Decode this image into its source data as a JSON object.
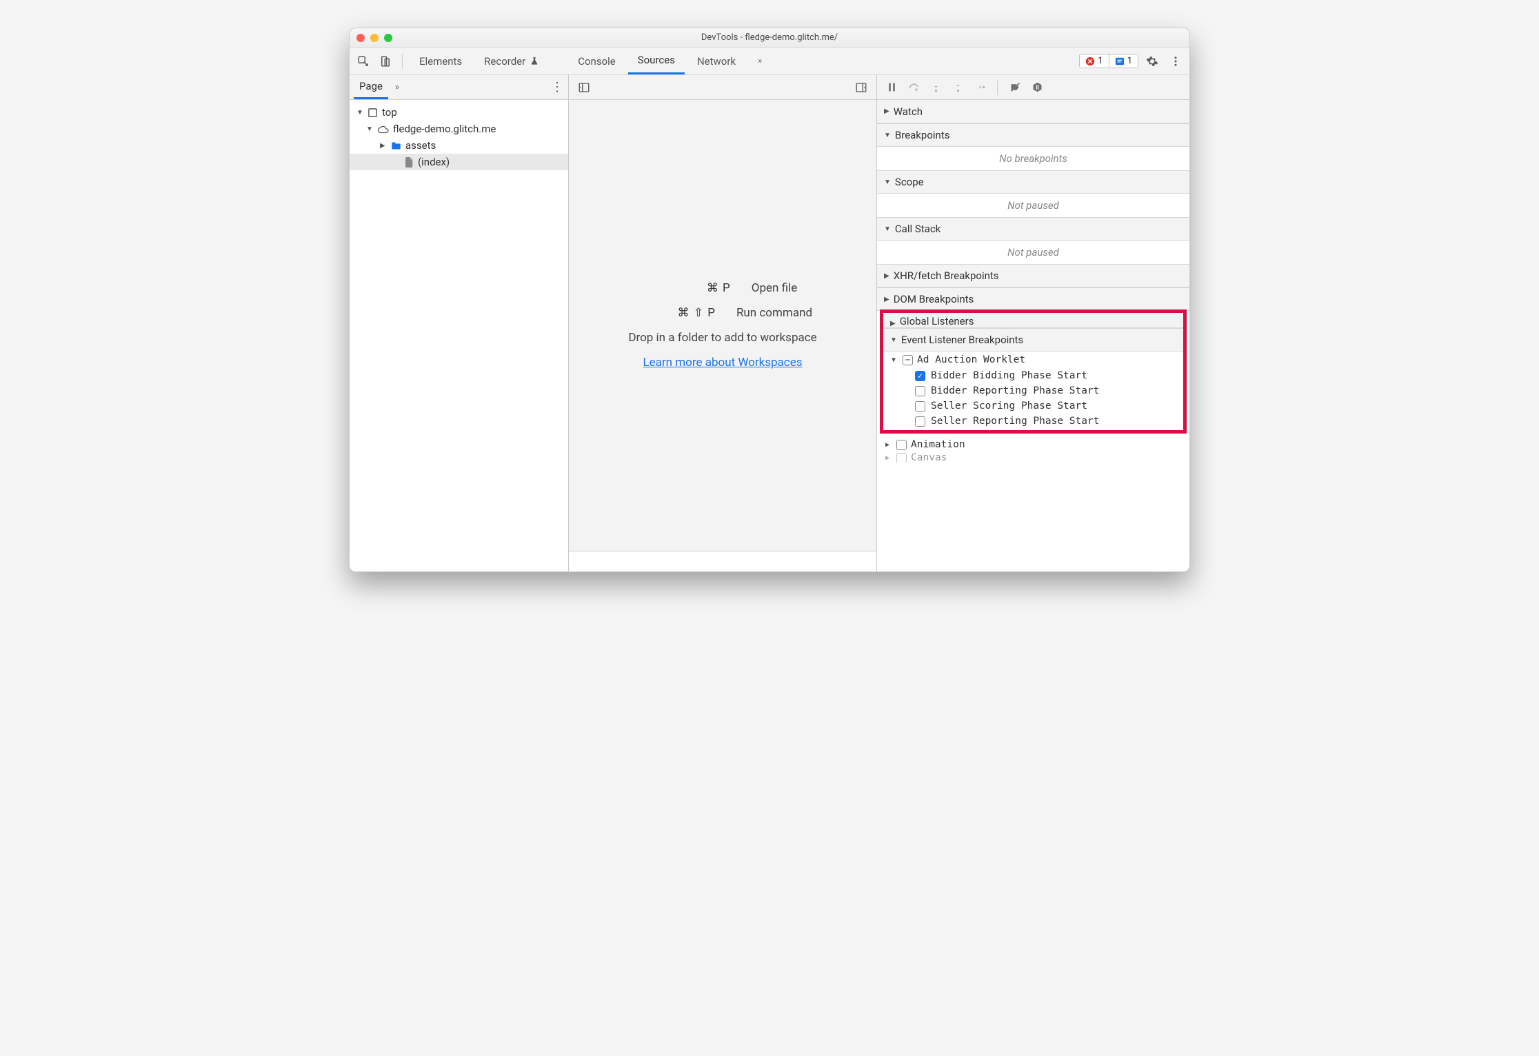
{
  "window": {
    "title": "DevTools - fledge-demo.glitch.me/"
  },
  "tabs": {
    "elements": "Elements",
    "recorder": "Recorder",
    "console": "Console",
    "sources": "Sources",
    "network": "Network"
  },
  "badges": {
    "errors": "1",
    "issues": "1"
  },
  "left": {
    "page_tab": "Page",
    "tree": {
      "top": "top",
      "domain": "fledge-demo.glitch.me",
      "assets": "assets",
      "index": "(index)"
    }
  },
  "center": {
    "open_keys": "⌘ P",
    "open_label": "Open file",
    "run_keys": "⌘ ⇧ P",
    "run_label": "Run command",
    "drop": "Drop in a folder to add to workspace",
    "link": "Learn more about Workspaces"
  },
  "right": {
    "watch": "Watch",
    "breakpoints": "Breakpoints",
    "no_breakpoints": "No breakpoints",
    "scope": "Scope",
    "not_paused_scope": "Not paused",
    "callstack": "Call Stack",
    "not_paused_cs": "Not paused",
    "xhr": "XHR/fetch Breakpoints",
    "dom": "DOM Breakpoints",
    "global": "Global Listeners",
    "elb": "Event Listener Breakpoints",
    "ad_auction": "Ad Auction Worklet",
    "events": {
      "bidder_bidding": "Bidder Bidding Phase Start",
      "bidder_reporting": "Bidder Reporting Phase Start",
      "seller_scoring": "Seller Scoring Phase Start",
      "seller_reporting": "Seller Reporting Phase Start"
    },
    "animation": "Animation",
    "canvas": "Canvas"
  }
}
